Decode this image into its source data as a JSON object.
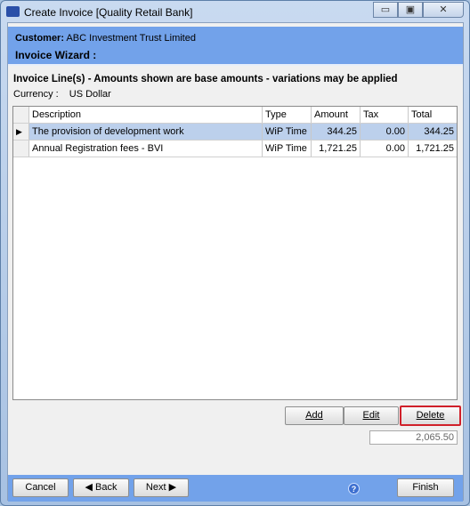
{
  "window": {
    "title": "Create Invoice [Quality Retail Bank]",
    "minimize_icon": "minimize-icon",
    "maximize_icon": "maximize-icon",
    "close_icon": "close-icon"
  },
  "header": {
    "customer_label": "Customer:",
    "customer_name": "ABC Investment Trust Limited",
    "wizard_label": "Invoice Wizard :"
  },
  "section": {
    "title": "Invoice Line(s) - Amounts shown are base amounts - variations may be applied",
    "currency_label": "Currency :",
    "currency_value": "US Dollar"
  },
  "grid": {
    "columns": [
      "Description",
      "Type",
      "Amount",
      "Tax",
      "Total"
    ],
    "rows": [
      {
        "description": "The provision of development work",
        "type": "WiP Time",
        "amount": "344.25",
        "tax": "0.00",
        "total": "344.25",
        "selected": true
      },
      {
        "description": "Annual Registration fees - BVI",
        "type": "WiP Time",
        "amount": "1,721.25",
        "tax": "0.00",
        "total": "1,721.25",
        "selected": false
      }
    ]
  },
  "actions": {
    "add": "Add",
    "edit": "Edit",
    "delete": "Delete",
    "total": "2,065.50"
  },
  "footer": {
    "cancel": "Cancel",
    "back": "Back",
    "next": "Next",
    "finish": "Finish",
    "help_icon": "help-icon"
  },
  "colors": {
    "header_blue": "#72a2ea",
    "selection": "#bcd0ec",
    "highlight": "#d0202a"
  }
}
